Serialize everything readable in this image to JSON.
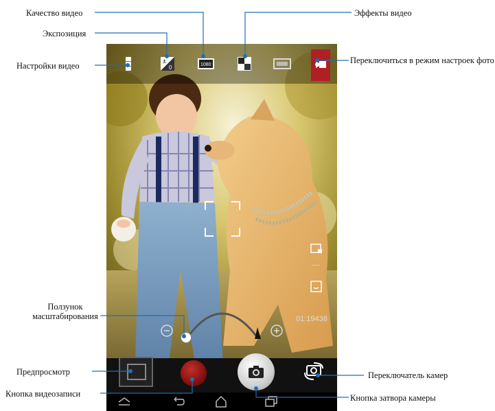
{
  "callouts": {
    "video_quality": "Качество видео",
    "exposure": "Экспозиция",
    "video_settings": "Настройки видео",
    "video_effects": "Эффекты видео",
    "switch_photo": "Переключиться в режим настроек фото",
    "zoom_slider": "Ползунок масштабирования",
    "preview": "Предпросмотр",
    "record_button": "Кнопка видеозаписи",
    "camera_switcher": "Переключатель камер",
    "shutter_button": "Кнопка затвора камеры"
  },
  "screen": {
    "remaining_counter": "01:19438"
  },
  "icons": {
    "settings": "video-settings-icon",
    "exposure": "exposure-icon",
    "quality": "video-quality-1080-icon",
    "effects": "video-effects-icon",
    "scene": "scene-mode-icon",
    "switch_photo": "switch-to-photo-icon"
  },
  "colors": {
    "callout_line": "#1f6fb5",
    "accent_red": "#b01f24",
    "record_red": "#8a0e0e"
  }
}
